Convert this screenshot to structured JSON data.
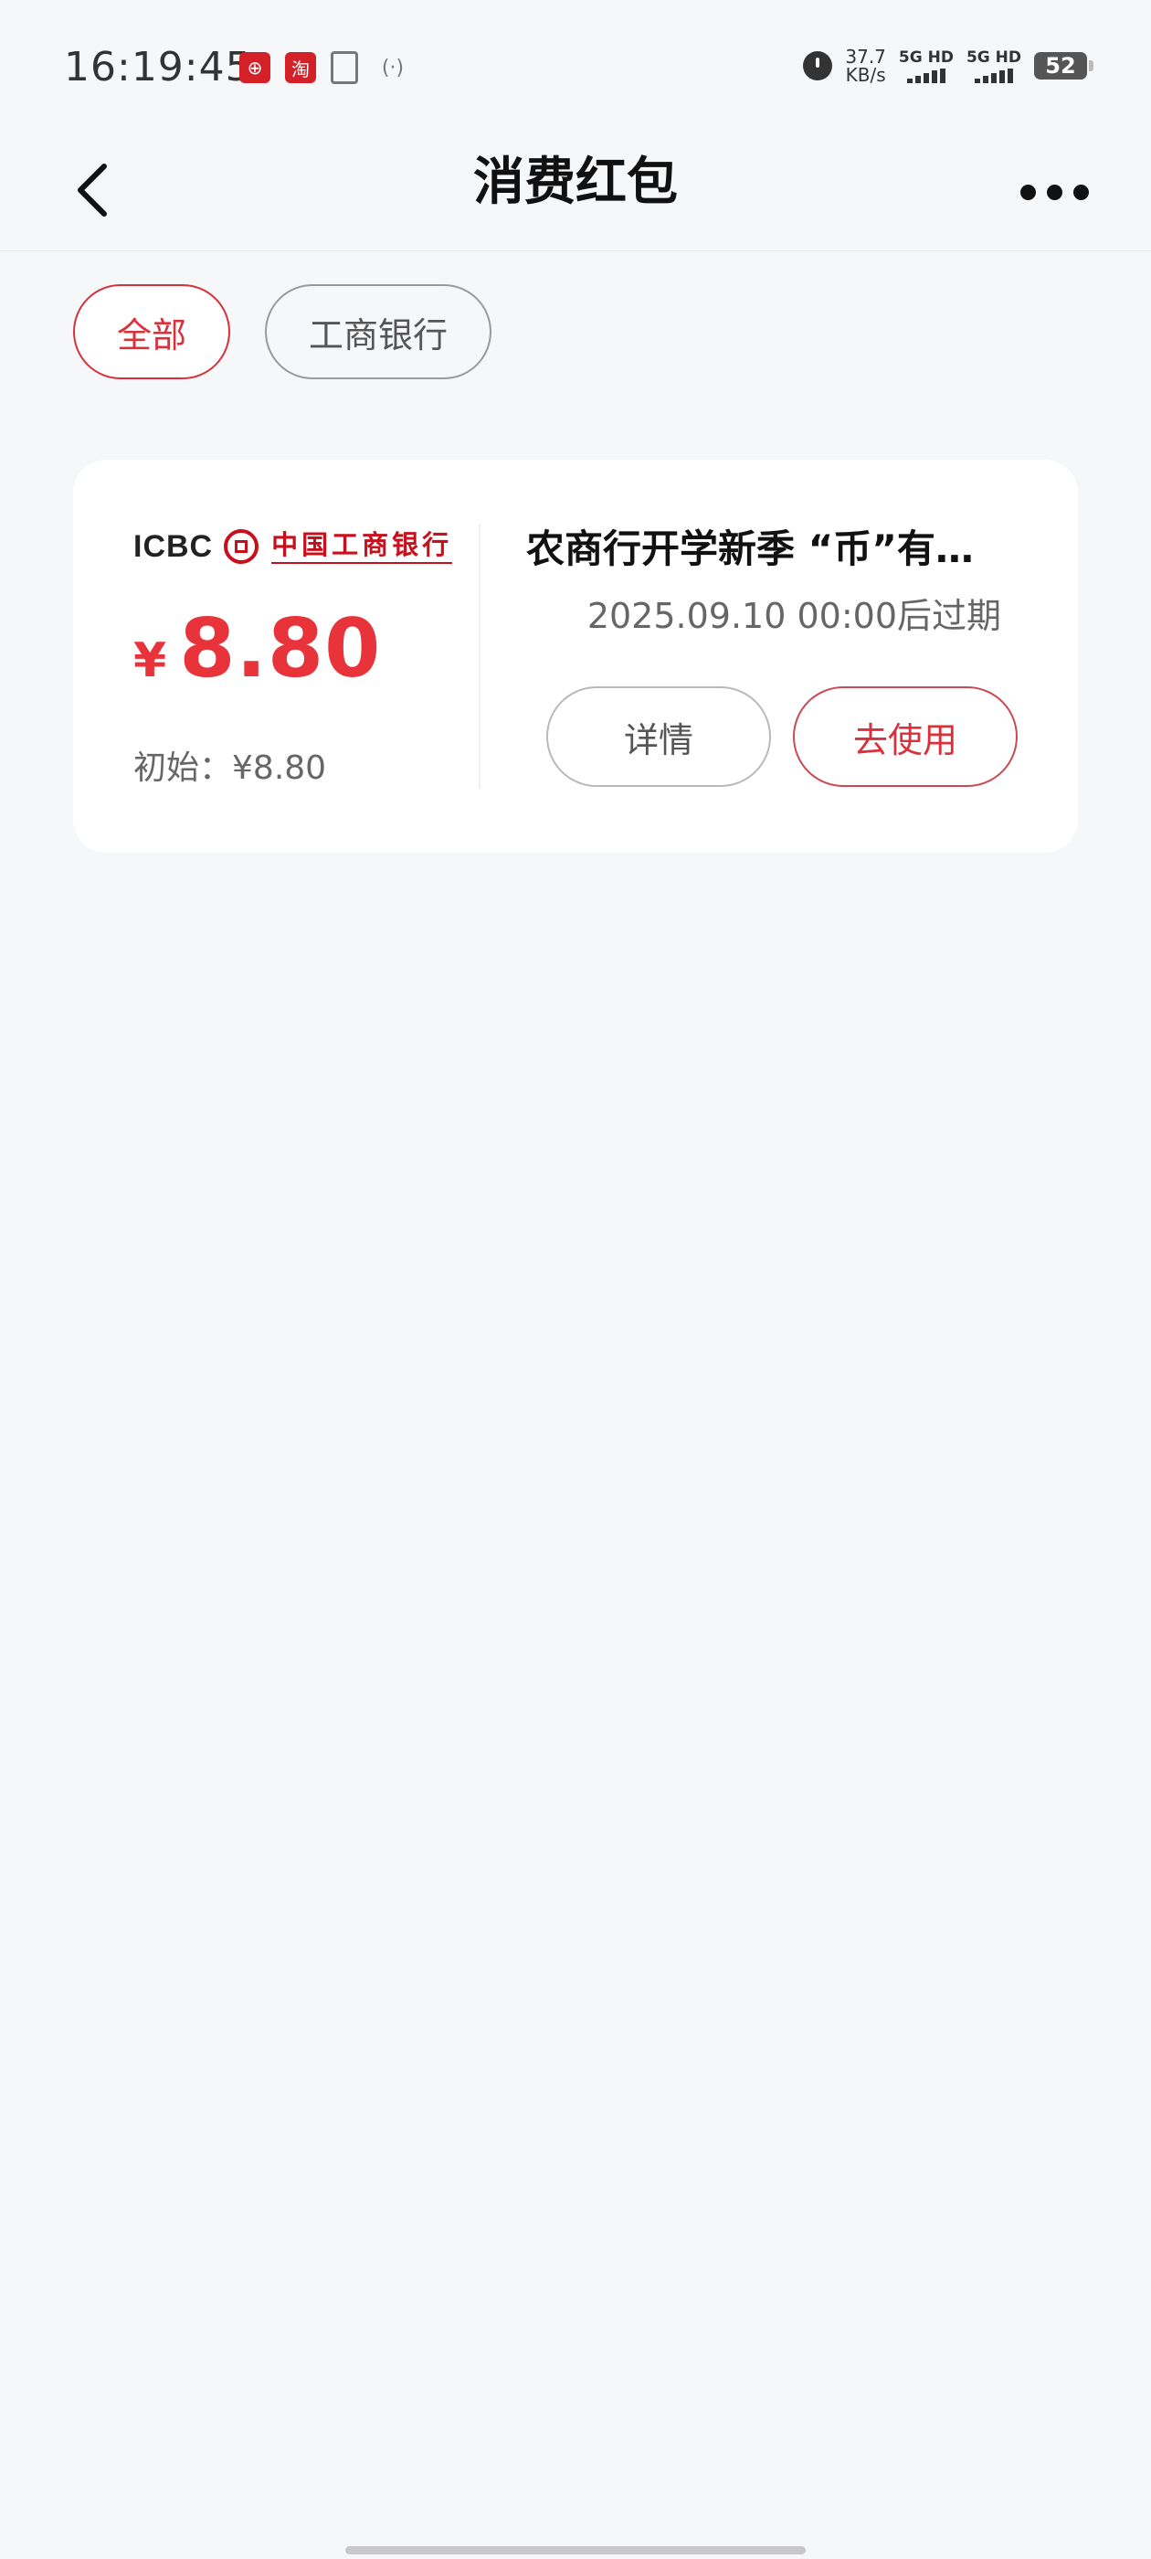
{
  "status_bar": {
    "time": "16:19:45",
    "net_speed_value": "37.7",
    "net_speed_unit": "KB/s",
    "sim1_label": "5G HD",
    "sim2_label": "5G HD",
    "battery": "52"
  },
  "nav": {
    "title": "消费红包"
  },
  "filters": [
    {
      "label": "全部",
      "active": true
    },
    {
      "label": "工商银行",
      "active": false
    }
  ],
  "coupon": {
    "brand_short": "ICBC",
    "brand_name": "中国工商银行",
    "currency": "¥",
    "amount": "8.80",
    "initial_label": "初始：",
    "initial_value": "¥8.80",
    "title": "农商行开学新季 “币”有…",
    "expiry": "2025.09.10 00:00后过期",
    "detail_label": "详情",
    "use_label": "去使用"
  },
  "colors": {
    "accent_red": "#d9303a",
    "brand_red": "#c8101c",
    "background": "#f6f7f9"
  }
}
